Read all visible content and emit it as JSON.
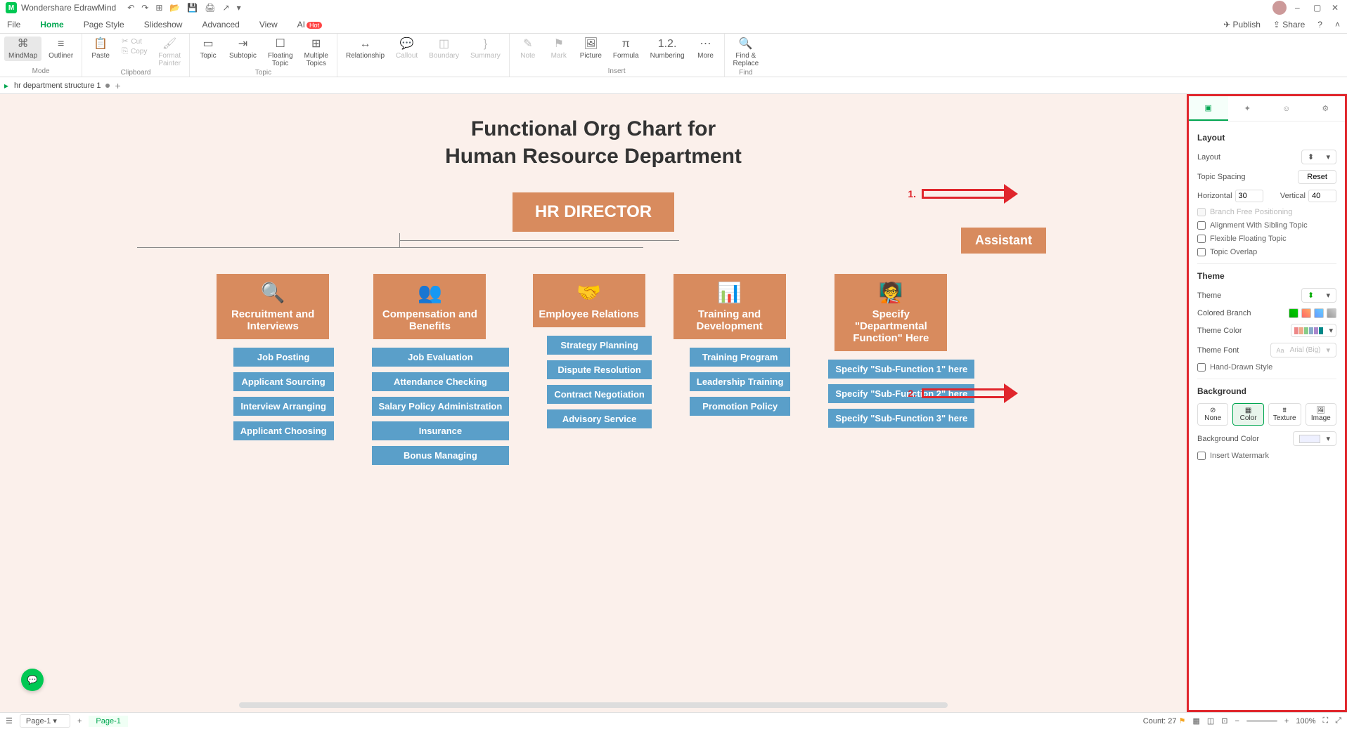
{
  "app": {
    "title": "Wondershare EdrawMind"
  },
  "quick_access": [
    "undo",
    "redo",
    "new",
    "open",
    "save",
    "print",
    "export"
  ],
  "window_controls": {
    "min": "–",
    "max": "▢",
    "close": "✕"
  },
  "menu": {
    "tabs": [
      "File",
      "Home",
      "Page Style",
      "Slideshow",
      "Advanced",
      "View",
      "AI"
    ],
    "active": "Home",
    "ai_badge": "Hot",
    "publish": "Publish",
    "share": "Share"
  },
  "ribbon": {
    "mode": {
      "mindmap": "MindMap",
      "outliner": "Outliner",
      "label": "Mode"
    },
    "clipboard": {
      "paste": "Paste",
      "cut": "Cut",
      "copy": "Copy",
      "format_painter": "Format\nPainter",
      "label": "Clipboard"
    },
    "topic": {
      "topic": "Topic",
      "subtopic": "Subtopic",
      "floating": "Floating\nTopic",
      "multiple": "Multiple\nTopics",
      "label": "Topic"
    },
    "connect": {
      "relationship": "Relationship",
      "callout": "Callout",
      "boundary": "Boundary",
      "summary": "Summary"
    },
    "insert": {
      "note": "Note",
      "mark": "Mark",
      "picture": "Picture",
      "formula": "Formula",
      "numbering": "Numbering",
      "more": "More",
      "label": "Insert"
    },
    "find": {
      "findreplace": "Find &\nReplace",
      "label": "Find"
    }
  },
  "doc_tab": {
    "name": "hr department structure 1"
  },
  "chart": {
    "title_line1": "Functional Org Chart for",
    "title_line2": "Human Resource Department",
    "root": "HR DIRECTOR",
    "assistant": "Assistant",
    "depts": [
      {
        "name": "Recruitment and Interviews",
        "icon": "🔍",
        "subs": [
          "Job Posting",
          "Applicant Sourcing",
          "Interview Arranging",
          "Applicant Choosing"
        ]
      },
      {
        "name": "Compensation and Benefits",
        "icon": "👥",
        "subs": [
          "Job Evaluation",
          "Attendance Checking",
          "Salary Policy Administration",
          "Insurance",
          "Bonus Managing"
        ]
      },
      {
        "name": "Employee Relations",
        "icon": "🤝",
        "subs": [
          "Strategy Planning",
          "Dispute Resolution",
          "Contract Negotiation",
          "Advisory Service"
        ]
      },
      {
        "name": "Training and Development",
        "icon": "📊",
        "subs": [
          "Training Program",
          "Leadership Training",
          "Promotion Policy"
        ]
      },
      {
        "name": "Specify \"Departmental Function\" Here",
        "icon": "🧑‍🏫",
        "subs": [
          "Specify \"Sub-Function 1\" here",
          "Specify \"Sub-Function 2\" here",
          "Specify \"Sub-Function 3\" here"
        ]
      }
    ]
  },
  "annotations": {
    "one": "1.",
    "two": "2."
  },
  "panel": {
    "layout_title": "Layout",
    "layout_label": "Layout",
    "topic_spacing": "Topic Spacing",
    "reset": "Reset",
    "horizontal": "Horizontal",
    "horizontal_val": "30",
    "vertical": "Vertical",
    "vertical_val": "40",
    "branch_free": "Branch Free Positioning",
    "alignment_sibling": "Alignment With Sibling Topic",
    "flexible_floating": "Flexible Floating Topic",
    "topic_overlap": "Topic Overlap",
    "theme_title": "Theme",
    "theme_label": "Theme",
    "colored_branch": "Colored Branch",
    "theme_color": "Theme Color",
    "theme_font": "Theme Font",
    "theme_font_val": "Arial (Big)",
    "hand_drawn": "Hand-Drawn Style",
    "background_title": "Background",
    "bg_none": "None",
    "bg_color": "Color",
    "bg_texture": "Texture",
    "bg_image": "Image",
    "bg_color_label": "Background Color",
    "insert_watermark": "Insert Watermark"
  },
  "status": {
    "page_dd": "Page-1",
    "page_tab": "Page-1",
    "count_label": "Count: 27",
    "zoom": "100%"
  }
}
